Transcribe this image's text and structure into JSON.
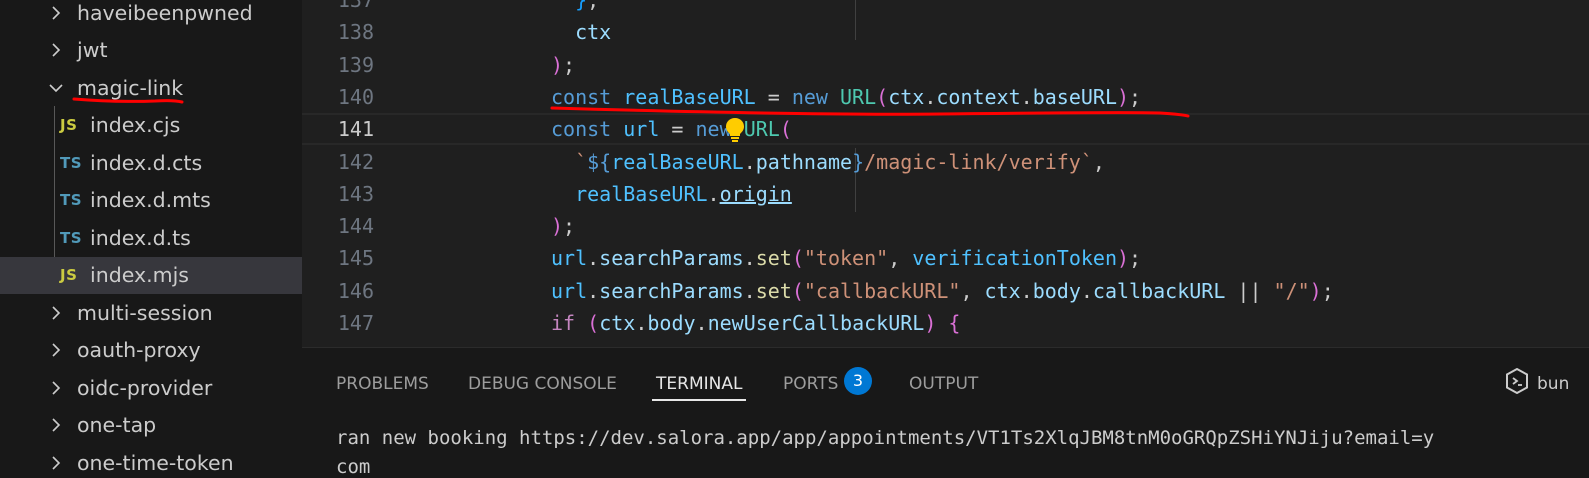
{
  "explorer": {
    "items": [
      {
        "label": "haveibeenpwned",
        "kind": "folder",
        "expanded": false
      },
      {
        "label": "jwt",
        "kind": "folder",
        "expanded": false
      },
      {
        "label": "magic-link",
        "kind": "folder",
        "expanded": true
      },
      {
        "label": "index.cjs",
        "kind": "file",
        "badge": "JS"
      },
      {
        "label": "index.d.cts",
        "kind": "file",
        "badge": "TS"
      },
      {
        "label": "index.d.mts",
        "kind": "file",
        "badge": "TS"
      },
      {
        "label": "index.d.ts",
        "kind": "file",
        "badge": "TS"
      },
      {
        "label": "index.mjs",
        "kind": "file",
        "badge": "JS",
        "selected": true
      },
      {
        "label": "multi-session",
        "kind": "folder",
        "expanded": false
      },
      {
        "label": "oauth-proxy",
        "kind": "folder",
        "expanded": false
      },
      {
        "label": "oidc-provider",
        "kind": "folder",
        "expanded": false
      },
      {
        "label": "one-tap",
        "kind": "folder",
        "expanded": false
      },
      {
        "label": "one-time-token",
        "kind": "folder",
        "expanded": false
      }
    ]
  },
  "editor": {
    "active_line": 141,
    "lines": [
      {
        "n": "137",
        "tokens": [
          {
            "t": "  "
          },
          {
            "t": "}",
            "c": "b3"
          },
          {
            "t": ","
          }
        ]
      },
      {
        "n": "138",
        "tokens": [
          {
            "t": "  "
          },
          {
            "t": "ctx",
            "c": "p"
          }
        ]
      },
      {
        "n": "139",
        "tokens": [
          {
            "t": ")",
            "c": "b2"
          },
          {
            "t": ";"
          }
        ]
      },
      {
        "n": "140",
        "tokens": [
          {
            "t": "const",
            "c": "k"
          },
          {
            "t": " "
          },
          {
            "t": "realBaseURL",
            "c": "v"
          },
          {
            "t": " = "
          },
          {
            "t": "new",
            "c": "k"
          },
          {
            "t": " "
          },
          {
            "t": "URL",
            "c": "cls"
          },
          {
            "t": "(",
            "c": "b2"
          },
          {
            "t": "ctx",
            "c": "p"
          },
          {
            "t": "."
          },
          {
            "t": "context",
            "c": "p"
          },
          {
            "t": "."
          },
          {
            "t": "baseURL",
            "c": "p"
          },
          {
            "t": ")",
            "c": "b2"
          },
          {
            "t": ";"
          }
        ]
      },
      {
        "n": "141",
        "tokens": [
          {
            "t": "const",
            "c": "k"
          },
          {
            "t": " "
          },
          {
            "t": "url",
            "c": "v"
          },
          {
            "t": " = "
          },
          {
            "t": "new",
            "c": "k"
          },
          {
            "t": " "
          },
          {
            "t": "URL",
            "c": "cls"
          },
          {
            "t": "(",
            "c": "b2"
          }
        ]
      },
      {
        "n": "142",
        "tokens": [
          {
            "t": "  "
          },
          {
            "t": "`",
            "c": "s"
          },
          {
            "t": "${",
            "c": "k"
          },
          {
            "t": "realBaseURL",
            "c": "v"
          },
          {
            "t": "."
          },
          {
            "t": "pathname",
            "c": "p"
          },
          {
            "t": "}",
            "c": "k"
          },
          {
            "t": "/magic-link/verify`",
            "c": "s"
          },
          {
            "t": ","
          }
        ]
      },
      {
        "n": "143",
        "tokens": [
          {
            "t": "  "
          },
          {
            "t": "realBaseURL",
            "c": "v"
          },
          {
            "t": "."
          },
          {
            "t": "origin",
            "c": "p ul"
          }
        ]
      },
      {
        "n": "144",
        "tokens": [
          {
            "t": ")",
            "c": "b2"
          },
          {
            "t": ";"
          }
        ]
      },
      {
        "n": "145",
        "tokens": [
          {
            "t": "url",
            "c": "v"
          },
          {
            "t": "."
          },
          {
            "t": "searchParams",
            "c": "p"
          },
          {
            "t": "."
          },
          {
            "t": "set",
            "c": "f"
          },
          {
            "t": "(",
            "c": "b2"
          },
          {
            "t": "\"token\"",
            "c": "s"
          },
          {
            "t": ", "
          },
          {
            "t": "verificationToken",
            "c": "v"
          },
          {
            "t": ")",
            "c": "b2"
          },
          {
            "t": ";"
          }
        ]
      },
      {
        "n": "146",
        "tokens": [
          {
            "t": "url",
            "c": "v"
          },
          {
            "t": "."
          },
          {
            "t": "searchParams",
            "c": "p"
          },
          {
            "t": "."
          },
          {
            "t": "set",
            "c": "f"
          },
          {
            "t": "(",
            "c": "b2"
          },
          {
            "t": "\"callbackURL\"",
            "c": "s"
          },
          {
            "t": ", "
          },
          {
            "t": "ctx",
            "c": "p"
          },
          {
            "t": "."
          },
          {
            "t": "body",
            "c": "p"
          },
          {
            "t": "."
          },
          {
            "t": "callbackURL",
            "c": "p"
          },
          {
            "t": " || "
          },
          {
            "t": "\"/\"",
            "c": "s"
          },
          {
            "t": ")",
            "c": "b2"
          },
          {
            "t": ";"
          }
        ]
      },
      {
        "n": "147",
        "tokens": [
          {
            "t": "if",
            "c": "ctl"
          },
          {
            "t": " "
          },
          {
            "t": "(",
            "c": "b2"
          },
          {
            "t": "ctx",
            "c": "p"
          },
          {
            "t": "."
          },
          {
            "t": "body",
            "c": "p"
          },
          {
            "t": "."
          },
          {
            "t": "newUserCallbackURL",
            "c": "p"
          },
          {
            "t": ")",
            "c": "b2"
          },
          {
            "t": " "
          },
          {
            "t": "{",
            "c": "b2"
          }
        ]
      }
    ]
  },
  "panel": {
    "tabs": [
      {
        "label": "PROBLEMS"
      },
      {
        "label": "DEBUG CONSOLE"
      },
      {
        "label": "TERMINAL",
        "active": true
      },
      {
        "label": "PORTS"
      },
      {
        "label": "OUTPUT"
      }
    ],
    "ports_badge": "3",
    "terminal_name": "bun",
    "terminal_lines": [
      "ran new booking https://dev.salora.app/app/appointments/VT1Ts2XlqJBM8tnM0oGRQpZSHiYNJiju?email=y",
      "com"
    ]
  },
  "colors": {
    "annotation": "#ff0000",
    "accent": "#0078d4"
  }
}
